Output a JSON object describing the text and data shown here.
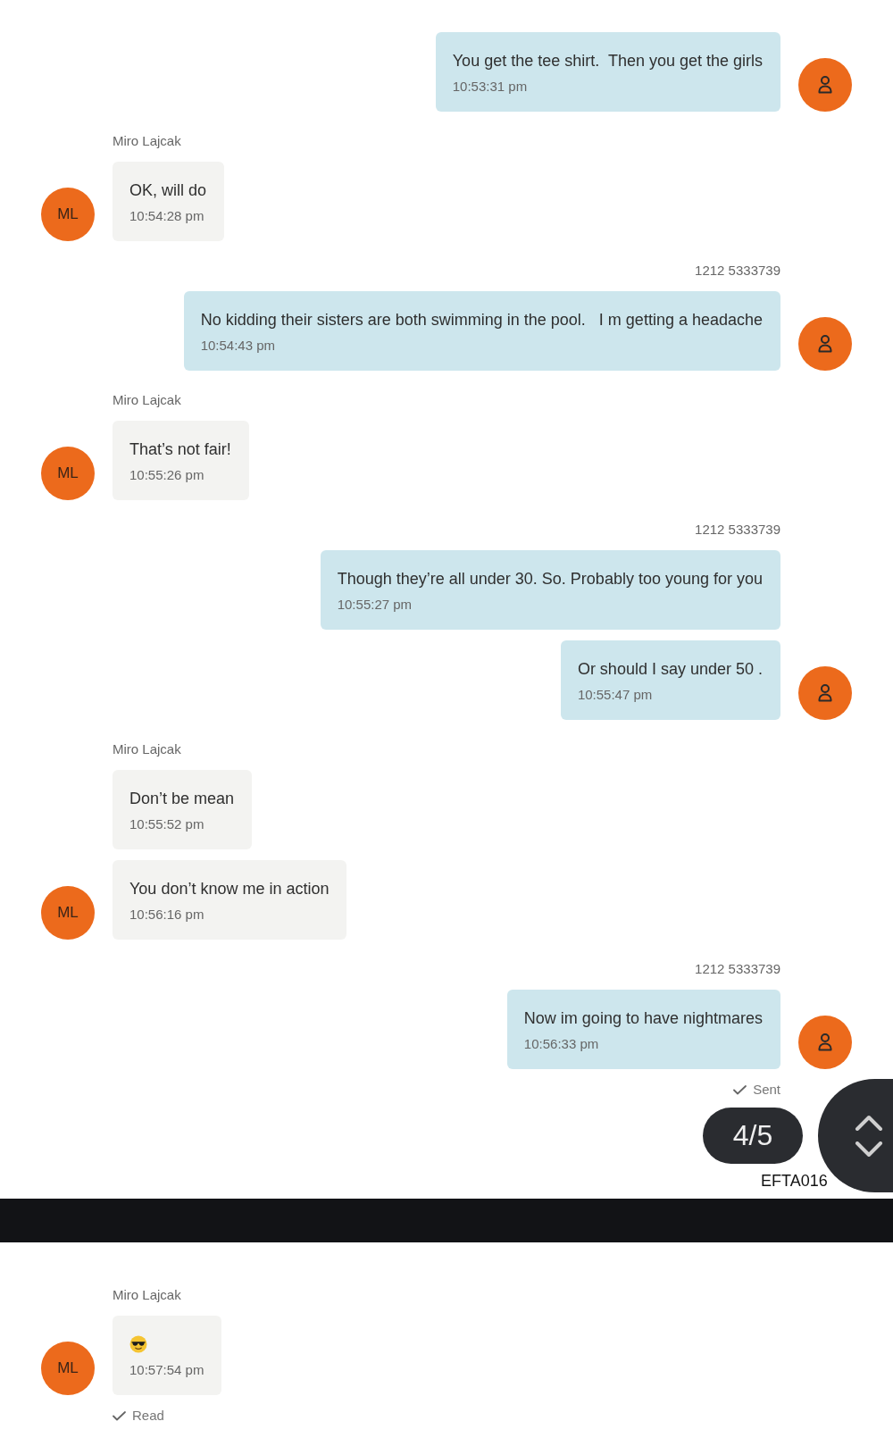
{
  "conversation": {
    "groups": [
      {
        "kind": "outgoing",
        "avatar": {
          "kind": "person"
        },
        "messages": [
          {
            "kind": "text",
            "text": "You get the tee shirt.  Then you get the girls",
            "time": "10:53:31 pm"
          }
        ]
      },
      {
        "kind": "incoming",
        "sender": "Miro Lajcak",
        "avatar": {
          "kind": "initials",
          "initials": "ML"
        },
        "messages": [
          {
            "kind": "text",
            "text": "OK, will do",
            "time": "10:54:28 pm"
          }
        ]
      },
      {
        "kind": "outgoing",
        "sender": "1212 5333739",
        "avatar": {
          "kind": "person"
        },
        "messages": [
          {
            "kind": "text",
            "text": "No kidding their sisters are both swimming in the pool.   I m getting a headache",
            "time": "10:54:43 pm"
          }
        ]
      },
      {
        "kind": "incoming",
        "sender": "Miro Lajcak",
        "avatar": {
          "kind": "initials",
          "initials": "ML"
        },
        "messages": [
          {
            "kind": "text",
            "text": "That’s not fair!",
            "time": "10:55:26 pm"
          }
        ]
      },
      {
        "kind": "outgoing",
        "sender": "1212 5333739",
        "avatar": {
          "kind": "person"
        },
        "messages": [
          {
            "kind": "text",
            "text": "Though they’re all under 30. So. Probably too young for you",
            "time": "10:55:27 pm"
          },
          {
            "kind": "text",
            "text": "Or should I say under 50 .",
            "time": "10:55:47 pm"
          }
        ]
      },
      {
        "kind": "incoming",
        "sender": "Miro Lajcak",
        "avatar": {
          "kind": "initials",
          "initials": "ML"
        },
        "messages": [
          {
            "kind": "text",
            "text": "Don’t be mean",
            "time": "10:55:52 pm"
          },
          {
            "kind": "text",
            "text": "You don’t know me in action",
            "time": "10:56:16 pm"
          }
        ]
      },
      {
        "kind": "outgoing",
        "sender": "1212 5333739",
        "avatar": {
          "kind": "person"
        },
        "messages": [
          {
            "kind": "text",
            "text": "Now im going to have nightmares",
            "time": "10:56:33 pm"
          }
        ],
        "status": {
          "text": "Sent"
        }
      }
    ]
  },
  "pager": {
    "counter": "4/5"
  },
  "stamp": "EFTA016",
  "continued_conversation": {
    "groups": [
      {
        "kind": "incoming",
        "sender": "Miro Lajcak",
        "avatar": {
          "kind": "initials",
          "initials": "ML"
        },
        "messages": [
          {
            "kind": "emoji",
            "time": "10:57:54 pm"
          }
        ],
        "status": {
          "text": "Read"
        }
      }
    ]
  }
}
